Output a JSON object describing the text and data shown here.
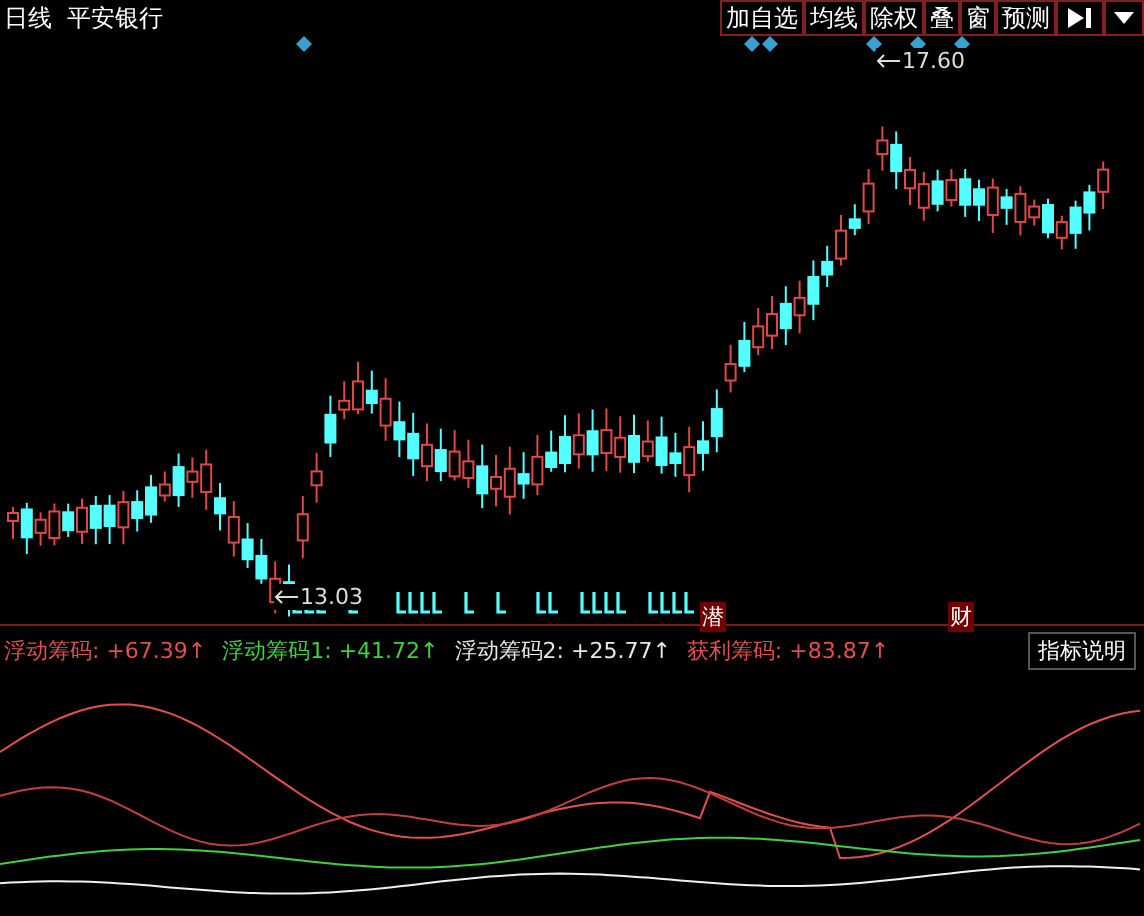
{
  "header": {
    "period": "日线",
    "stock": "平安银行"
  },
  "toolbar": [
    {
      "label": "加自选"
    },
    {
      "label": "均线"
    },
    {
      "label": "除权"
    },
    {
      "label": "叠"
    },
    {
      "label": "窗"
    },
    {
      "label": "预测"
    }
  ],
  "price_marks": [
    {
      "kind": "high",
      "text": "17.60"
    },
    {
      "kind": "low",
      "text": "13.03"
    }
  ],
  "signals": [
    {
      "text": "潜"
    },
    {
      "text": "财"
    }
  ],
  "legend": [
    {
      "text": "浮动筹码: +67.39↑",
      "color": "#e05050"
    },
    {
      "text": "浮动筹码1: +41.72↑",
      "color": "#40d040"
    },
    {
      "text": "浮动筹码2: +25.77↑",
      "color": "#e8e8e8"
    },
    {
      "text": "获利筹码: +83.87↑",
      "color": "#e05050"
    }
  ],
  "indicator_button": "指标说明"
}
